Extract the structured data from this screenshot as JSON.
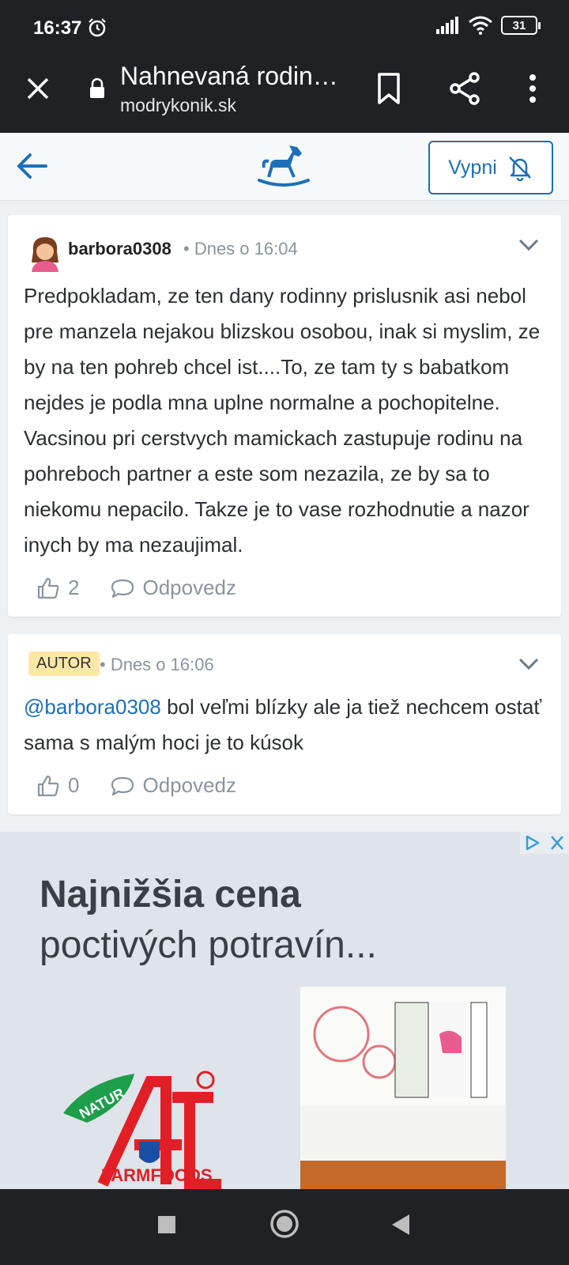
{
  "status_bar": {
    "time": "16:37",
    "battery": "31"
  },
  "browser": {
    "tab_title": "Nahnevaná rodin…",
    "url": "modrykonik.sk"
  },
  "site_header": {
    "notify_button_label": "Vypni"
  },
  "comments": [
    {
      "author": "barbora0308",
      "meta": "• Dnes o 16:04",
      "text": "Predpokladam, ze ten dany rodinny prislusnik asi nebol pre manzela nejakou blizskou osobou, inak si myslim, ze by na ten pohreb chcel ist....To, ze tam ty s babatkom nejdes je podla mna uplne normalne a pochopitelne. Vacsinou pri cerstvych mamickach zastupuje rodinu na pohreboch partner a este som nezazila, ze by sa to niekomu nepacilo. Takze je to vase rozhodnutie a nazor inych by ma nezaujimal.",
      "likes": "2",
      "reply_label": "Odpovedz"
    },
    {
      "badge": "AUTOR",
      "meta": "• Dnes o 16:06",
      "mention": "@barbora0308",
      "text": " bol veľmi blízky ale ja tiež nechcem ostať sama s malým hoci je to kúsok",
      "likes": "0",
      "reply_label": "Odpovedz"
    }
  ],
  "ad": {
    "headline": "Najnižšia cena",
    "subline": "poctivých potravín...",
    "logo_badge": "NATUR",
    "brand": "FARMFOODS"
  },
  "colors": {
    "accent": "#1d6fb8",
    "badge": "#fde8a8",
    "dark": "#202124"
  }
}
